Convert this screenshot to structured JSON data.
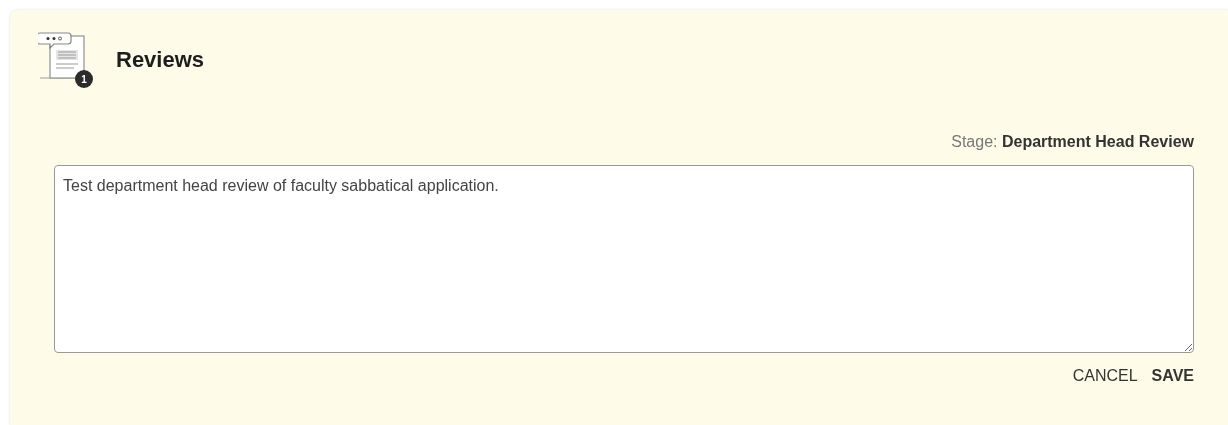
{
  "header": {
    "title": "Reviews",
    "badge": "1"
  },
  "stage": {
    "label": "Stage:",
    "value": "Department Head Review"
  },
  "review": {
    "value": "Test department head review of faculty sabbatical application."
  },
  "buttons": [
    {
      "label": "CANCEL",
      "kind": "secondary"
    },
    {
      "label": "SAVE",
      "kind": "primary"
    }
  ]
}
